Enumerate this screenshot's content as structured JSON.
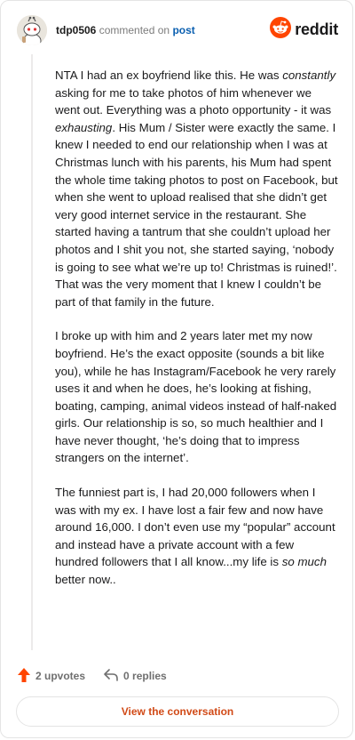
{
  "header": {
    "username": "tdp0506",
    "action_text": "commented on",
    "post_link": "post",
    "brand": "reddit"
  },
  "comment": {
    "p1": {
      "a": "NTA I had an ex boyfriend like this. He was ",
      "em1": "constantly",
      "b": " asking for me to take photos of him whenever we went out. Everything was a photo opportunity - it was ",
      "em2": "exhausting",
      "c": ". His Mum / Sister were exactly the same. I knew I needed to end our relationship when I was at Christmas lunch with his parents, his Mum had spent the whole time taking photos to post on Facebook, but when she went to upload realised that she didn’t get very good internet service in the restaurant. She started having a tantrum that she couldn’t upload her photos and I shit you not, she started saying, ‘nobody is going to see what we’re up to! Christmas is ruined!’. That was the very moment that I knew I couldn’t be part of that family in the future."
    },
    "p2": "I broke up with him and 2 years later met my now boyfriend. He’s the exact opposite (sounds a bit like you), while he has Instagram/Facebook he very rarely uses it and when he does, he’s looking at fishing, boating, camping, animal videos instead of half-naked girls. Our relationship is so, so much healthier and I have never thought, ‘he’s doing that to impress strangers on the internet’.",
    "p3": {
      "a": "The funniest part is, I had 20,000 followers when I was with my ex. I have lost a fair few and now have around 16,000. I don’t even use my “popular” account and instead have a private account with a few hundred followers that I all know...my life is ",
      "em": "so much",
      "b": " better now.."
    }
  },
  "actions": {
    "upvotes": "2 upvotes",
    "replies": "0 replies"
  },
  "cta": {
    "label": "View the conversation"
  },
  "colors": {
    "upvote": "#ff4500",
    "link": "#0a5fb0",
    "cta_text": "#d14a17",
    "brand": "#ff4500"
  },
  "icons": [
    "snoo-avatar-icon",
    "reddit-logo-icon",
    "upvote-arrow-icon",
    "reply-icon"
  ]
}
